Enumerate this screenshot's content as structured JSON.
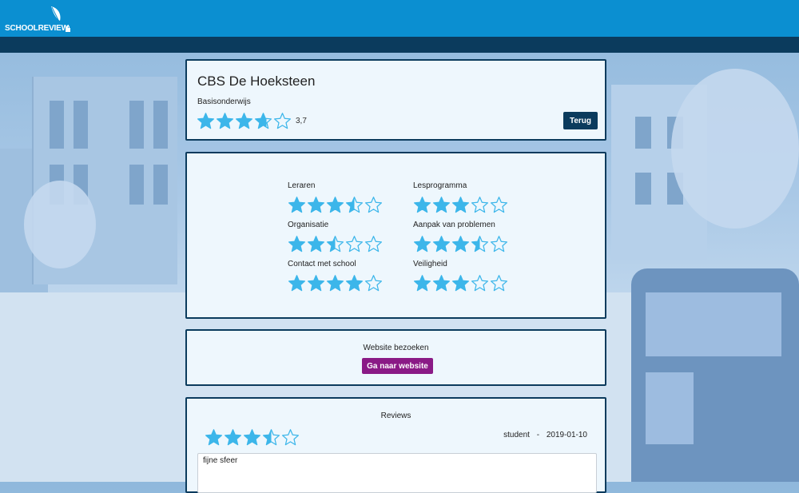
{
  "header": {
    "logo_text": "SCHOOLREVIEW",
    "colors": {
      "topbar": "#0b8fd1",
      "subbar": "#0b3b5d"
    }
  },
  "school": {
    "name": "CBS De Hoeksteen",
    "type": "Basisonderwijs",
    "rating": 3.7,
    "rating_label": "3,7",
    "back_label": "Terug"
  },
  "categories": [
    {
      "label": "Leraren",
      "rating": 3.5
    },
    {
      "label": "Lesprogramma",
      "rating": 3
    },
    {
      "label": "Organisatie",
      "rating": 2.5
    },
    {
      "label": "Aanpak van problemen",
      "rating": 3.5
    },
    {
      "label": "Contact met school",
      "rating": 4
    },
    {
      "label": "Veiligheid",
      "rating": 3
    }
  ],
  "website": {
    "label": "Website bezoeken",
    "button_label": "Ga naar website",
    "button_color": "#8a1a86"
  },
  "reviews": {
    "title": "Reviews",
    "items": [
      {
        "rating": 3.5,
        "author": "student",
        "separator": "-",
        "date": "2019-01-10",
        "text": "fijne sfeer"
      }
    ]
  },
  "icons": {
    "star": "star-icon",
    "logo": "feather-icon"
  },
  "star_color": "#3cb6ea"
}
